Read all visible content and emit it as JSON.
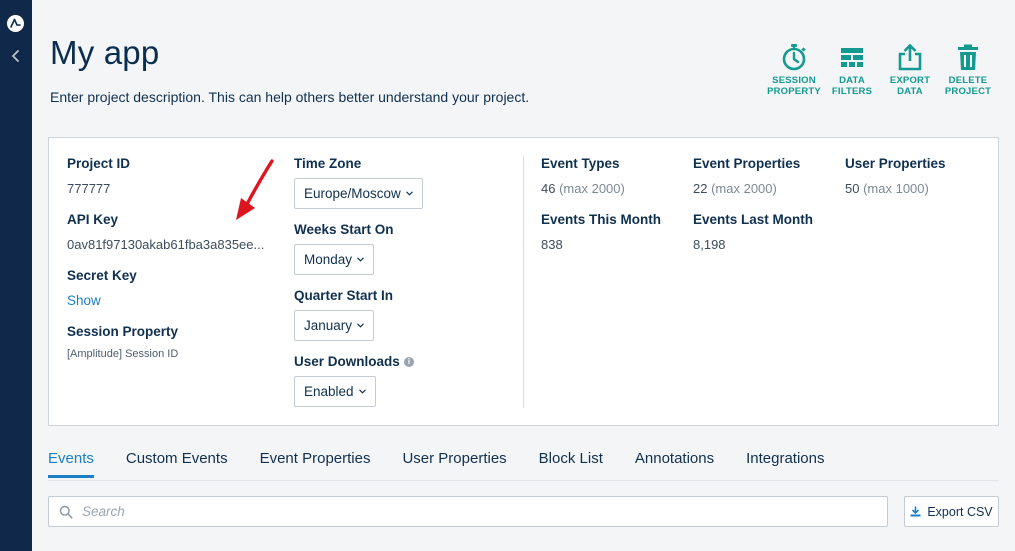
{
  "header": {
    "title": "My app",
    "description": "Enter project description. This can help others better understand your project."
  },
  "actions": [
    {
      "label": "SESSION\nPROPERTY",
      "icon": "stopwatch-icon"
    },
    {
      "label": "DATA\nFILTERS",
      "icon": "filter-grid-icon"
    },
    {
      "label": "EXPORT\nDATA",
      "icon": "export-icon"
    },
    {
      "label": "DELETE\nPROJECT",
      "icon": "trash-icon"
    }
  ],
  "project": {
    "id_label": "Project ID",
    "id_value": "777777",
    "api_key_label": "API Key",
    "api_key_value": "0av81f97130akab61fba3a835ee...",
    "secret_key_label": "Secret Key",
    "secret_key_action": "Show",
    "session_property_label": "Session Property",
    "session_property_value": "[Amplitude] Session ID"
  },
  "settings": {
    "timezone_label": "Time Zone",
    "timezone_value": "Europe/Moscow",
    "weeks_label": "Weeks Start On",
    "weeks_value": "Monday",
    "quarter_label": "Quarter Start In",
    "quarter_value": "January",
    "downloads_label": "User Downloads",
    "downloads_value": "Enabled"
  },
  "stats": {
    "event_types_label": "Event Types",
    "event_types_value": "46",
    "event_types_max": "(max 2000)",
    "event_props_label": "Event Properties",
    "event_props_value": "22",
    "event_props_max": "(max 2000)",
    "user_props_label": "User Properties",
    "user_props_value": "50",
    "user_props_max": "(max 1000)",
    "events_month_label": "Events This Month",
    "events_month_value": "838",
    "events_last_label": "Events Last Month",
    "events_last_value": "8,198"
  },
  "tabs": [
    "Events",
    "Custom Events",
    "Event Properties",
    "User Properties",
    "Block List",
    "Annotations",
    "Integrations"
  ],
  "active_tab": "Events",
  "search": {
    "placeholder": "Search"
  },
  "export_csv_label": "Export CSV",
  "colors": {
    "rail": "#10294a",
    "accent_teal": "#139a91",
    "link_blue": "#1c7fc4",
    "annotation_red": "#e0141e"
  }
}
